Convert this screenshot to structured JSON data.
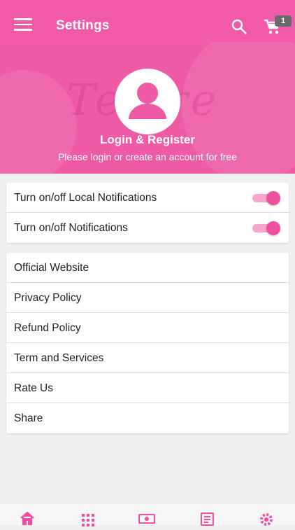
{
  "appbar": {
    "title": "Settings",
    "menu_icon": "menu-icon",
    "search_icon": "search-icon",
    "cart_icon": "cart-icon",
    "cart_count": "1",
    "background": "#f05aa6"
  },
  "hero": {
    "background": "#ee5aa4",
    "bg_text": "Temre",
    "avatar_icon": "user-avatar-icon",
    "title": "Login & Register",
    "subtitle": "Please login or create an account for free"
  },
  "notifications": [
    {
      "label": "Turn on/off Local Notifications",
      "enabled": true
    },
    {
      "label": "Turn on/off Notifications",
      "enabled": true
    }
  ],
  "links": [
    {
      "label": "Official Website"
    },
    {
      "label": "Privacy Policy"
    },
    {
      "label": "Refund Policy"
    },
    {
      "label": "Term and Services"
    },
    {
      "label": "Rate Us"
    },
    {
      "label": "Share"
    }
  ],
  "bottom_nav": [
    {
      "icon": "home-icon",
      "active": true
    },
    {
      "icon": "grid-icon",
      "active": false
    },
    {
      "icon": "money-icon",
      "active": false
    },
    {
      "icon": "news-icon",
      "active": false
    },
    {
      "icon": "gear-icon",
      "active": false
    }
  ],
  "accent_color": "#ef4f9f"
}
